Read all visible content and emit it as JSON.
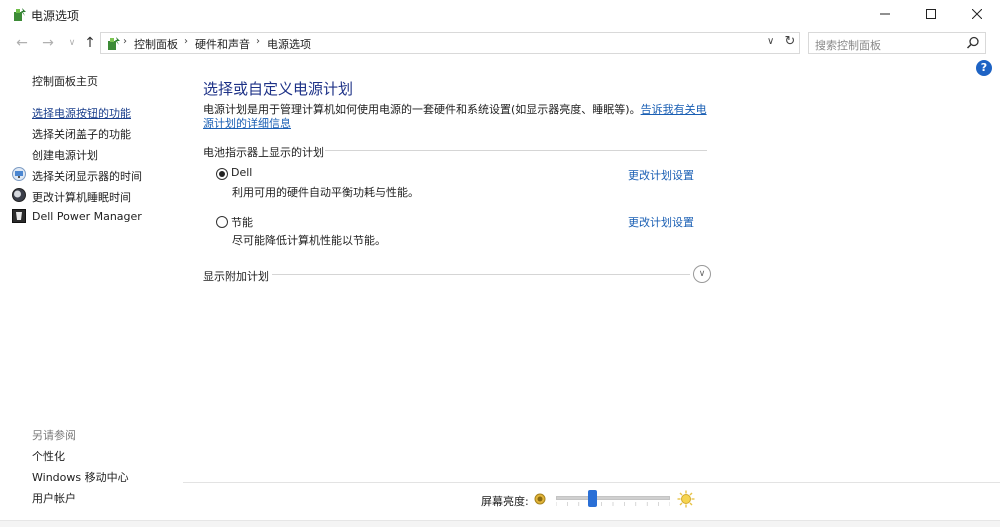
{
  "window": {
    "title": "电源选项",
    "icon": "power-options-icon"
  },
  "nav": {
    "breadcrumbs": [
      "控制面板",
      "硬件和声音",
      "电源选项"
    ],
    "search_placeholder": "搜索控制面板"
  },
  "left": {
    "home": "控制面板主页",
    "links": [
      {
        "label": "选择电源按钮的功能",
        "icon": "",
        "active": true
      },
      {
        "label": "选择关闭盖子的功能",
        "icon": ""
      },
      {
        "label": "创建电源计划",
        "icon": ""
      },
      {
        "label": "选择关闭显示器的时间",
        "icon": "monitor-icon"
      },
      {
        "label": "更改计算机睡眠时间",
        "icon": "moon-icon"
      },
      {
        "label": "Dell Power Manager",
        "icon": "dell-power-icon"
      }
    ],
    "see_also_title": "另请参阅",
    "see_also": [
      "个性化",
      "Windows 移动中心",
      "用户帐户"
    ]
  },
  "main": {
    "title": "选择或自定义电源计划",
    "desc_text": "电源计划是用于管理计算机如何使用电源的一套硬件和系统设置(如显示器亮度、睡眠等)。",
    "desc_link": "告诉我有关电源计划的详细信息",
    "section_title": "电池指示器上显示的计划",
    "plans": [
      {
        "name": "Dell",
        "desc": "利用可用的硬件自动平衡功耗与性能。",
        "link": "更改计划设置",
        "selected": true
      },
      {
        "name": "节能",
        "desc": "尽可能降低计算机性能以节能。",
        "link": "更改计划设置",
        "selected": false
      }
    ],
    "additional_plans": "显示附加计划"
  },
  "brightness": {
    "label": "屏幕亮度:",
    "level_percent": 30
  },
  "colors": {
    "title_blue": "#1e3287",
    "link_blue": "#1a5fb4",
    "slider_blue": "#2a6fd6"
  }
}
